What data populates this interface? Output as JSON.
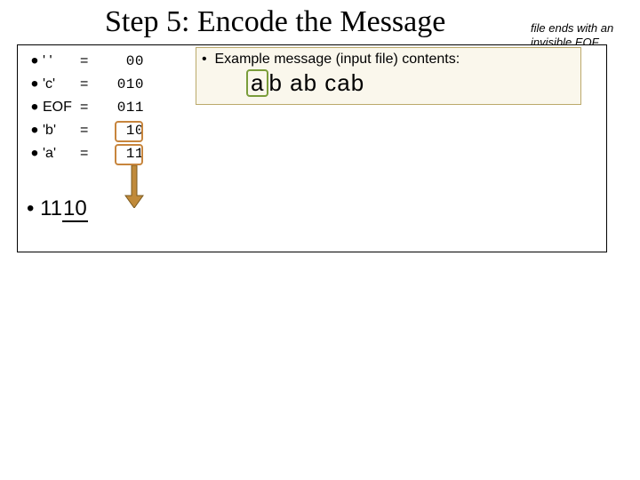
{
  "title": "Step 5: Encode the Message",
  "sidenote": "file ends with an invisible EOF character",
  "codes": {
    "r0": {
      "sym": "'  '",
      "eq": "=",
      "bits": "00"
    },
    "r1": {
      "sym": "'c'",
      "eq": "=",
      "bits": "010"
    },
    "r2": {
      "sym": "EOF",
      "eq": "=",
      "bits": "011"
    },
    "r3": {
      "sym": "'b'",
      "eq": "=",
      "bits": "10"
    },
    "r4": {
      "sym": "'a'",
      "eq": "=",
      "bits": "11"
    }
  },
  "example": {
    "head_bullet": "•",
    "head": "Example message (input file) contents:",
    "msg_p0": "a",
    "msg_p1": "b  ab  cab"
  },
  "result": {
    "bullet": "•",
    "prefix": "11",
    "encoded": "10"
  },
  "bullet": "•"
}
